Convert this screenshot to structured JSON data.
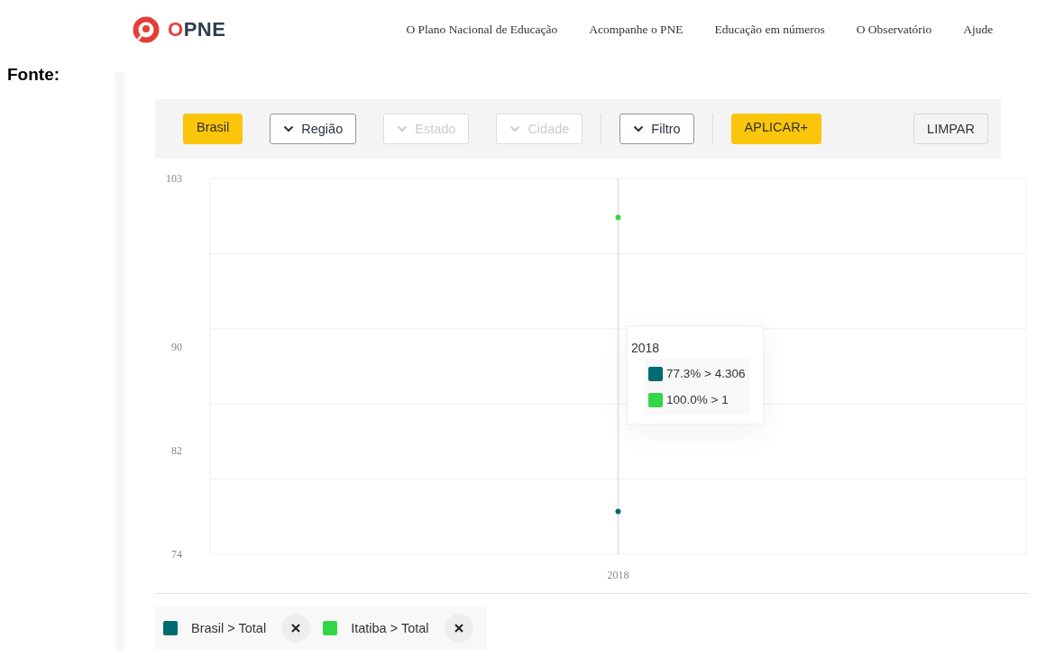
{
  "header": {
    "logo": "OPNE",
    "nav": [
      {
        "label": "O Plano Nacional de Educação"
      },
      {
        "label": "Acompanhe o PNE"
      },
      {
        "label": "Educação em números"
      },
      {
        "label": "O Observatório"
      },
      {
        "label": "Ajude"
      }
    ]
  },
  "side_label": "Fonte:",
  "toolbar": {
    "groups": [
      [
        {
          "kind": "primary",
          "label": "Brasil"
        },
        {
          "kind": "dropdown",
          "label": "Região",
          "disabled": false
        },
        {
          "kind": "dropdown",
          "label": "Estado",
          "disabled": true
        },
        {
          "kind": "dropdown",
          "label": "Cidade",
          "disabled": true
        }
      ],
      [
        {
          "kind": "dropdown",
          "label": "Filtro",
          "disabled": false
        }
      ],
      [
        {
          "kind": "primary",
          "label": "APLICAR+"
        }
      ]
    ],
    "clear_button": "LIMPAR"
  },
  "chart": {
    "chart_data": {
      "type": "line",
      "categories": [
        "2018"
      ],
      "series": [
        {
          "name": "Brasil > Total",
          "color": "#006b70",
          "marker": true,
          "values": [
            77.3
          ]
        },
        {
          "name": "Itatiba > Total",
          "color": "#33d646",
          "marker": true,
          "values": [
            100.0
          ]
        }
      ],
      "ylim": [
        74,
        103
      ],
      "yticks": [
        74,
        82,
        90,
        103
      ]
    },
    "tooltip": {
      "title": "2018",
      "items": [
        {
          "color": "#006b70",
          "text": "77.3% > 4.306"
        },
        {
          "color": "#33d646",
          "text": "100.0% > 1"
        }
      ]
    }
  }
}
